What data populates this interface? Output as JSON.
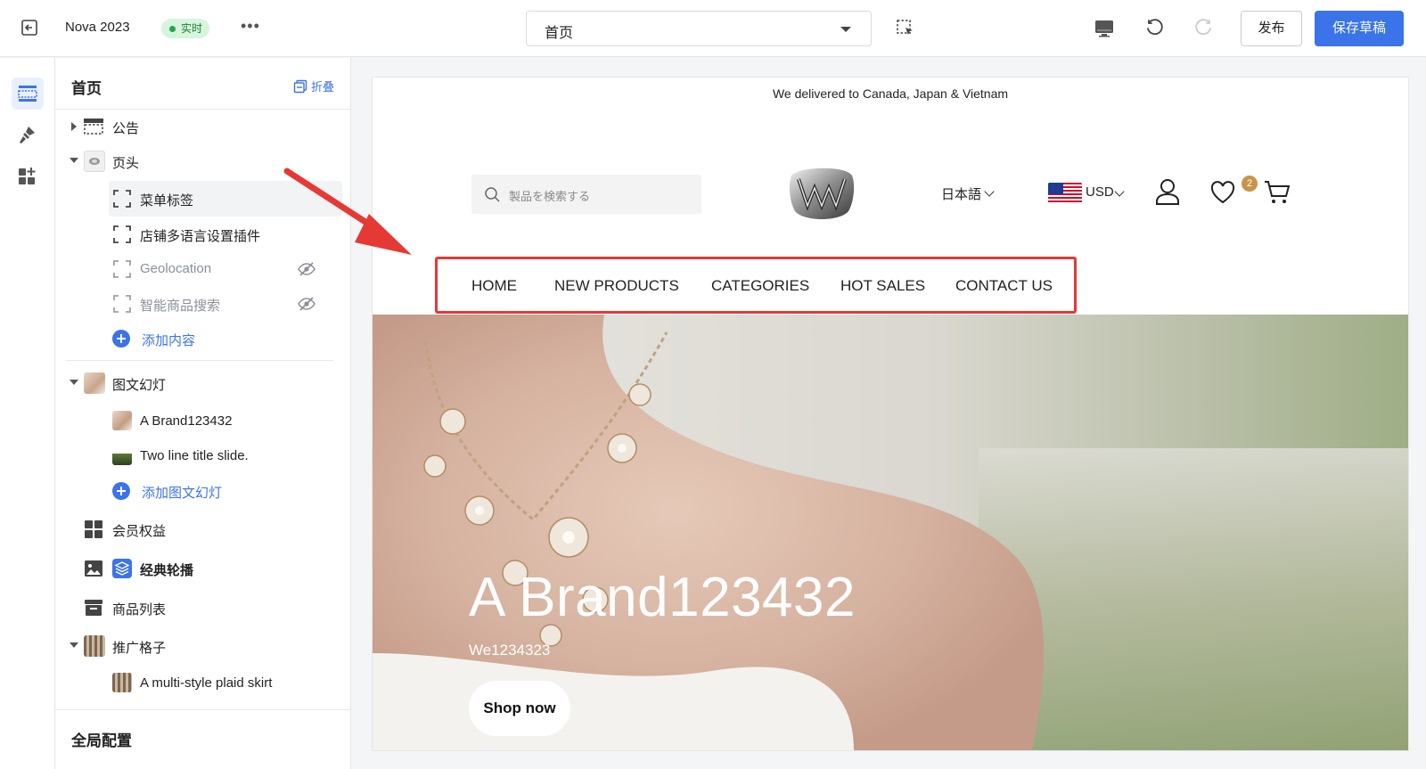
{
  "topbar": {
    "theme_name": "Nova 2023",
    "live_badge": "实时",
    "more": "•••",
    "page_select": "首页",
    "publish_label": "发布",
    "save_label": "保存草稿"
  },
  "panel": {
    "title": "首页",
    "collapse_label": "折叠",
    "items": [
      {
        "label": "公告",
        "icon": "announcement-icon"
      },
      {
        "label": "页头",
        "icon": "header-thumb"
      },
      {
        "label": "菜单标签",
        "icon": "block-icon",
        "selected": true
      },
      {
        "label": "店铺多语言设置插件",
        "icon": "block-icon"
      },
      {
        "label": "Geolocation",
        "icon": "block-icon",
        "hidden": true
      },
      {
        "label": "智能商品搜索",
        "icon": "block-icon",
        "hidden": true
      },
      {
        "label": "添加内容",
        "icon": "plus-icon"
      },
      {
        "label": "图文幻灯",
        "icon": "slideshow-thumb"
      },
      {
        "label": "A Brand123432",
        "icon": "slide-thumb"
      },
      {
        "label": "Two line title slide.",
        "icon": "slide-thumb"
      },
      {
        "label": "添加图文幻灯",
        "icon": "plus-icon"
      },
      {
        "label": "会员权益",
        "icon": "grid-icon"
      },
      {
        "label": "经典轮播",
        "icon": "layers-icon"
      },
      {
        "label": "商品列表",
        "icon": "archive-icon"
      },
      {
        "label": "推广格子",
        "icon": "skirt-thumb"
      },
      {
        "label": "A multi-style plaid skirt",
        "icon": "skirt-thumb"
      }
    ],
    "global_config": "全局配置"
  },
  "preview": {
    "announcement": "We delivered to Canada, Japan & Vietnam",
    "search_placeholder": "製品を検索する",
    "language": "日本語",
    "currency": "USD",
    "wishlist_count": "2",
    "nav": [
      "HOME",
      "NEW PRODUCTS",
      "CATEGORIES",
      "HOT SALES",
      "CONTACT US"
    ],
    "hero": {
      "title": "A Brand123432",
      "subtitle": "We1234323",
      "button": "Shop now"
    }
  },
  "colors": {
    "accent": "#3b73e9",
    "highlight": "#e53935",
    "live_green": "#20a84a"
  }
}
